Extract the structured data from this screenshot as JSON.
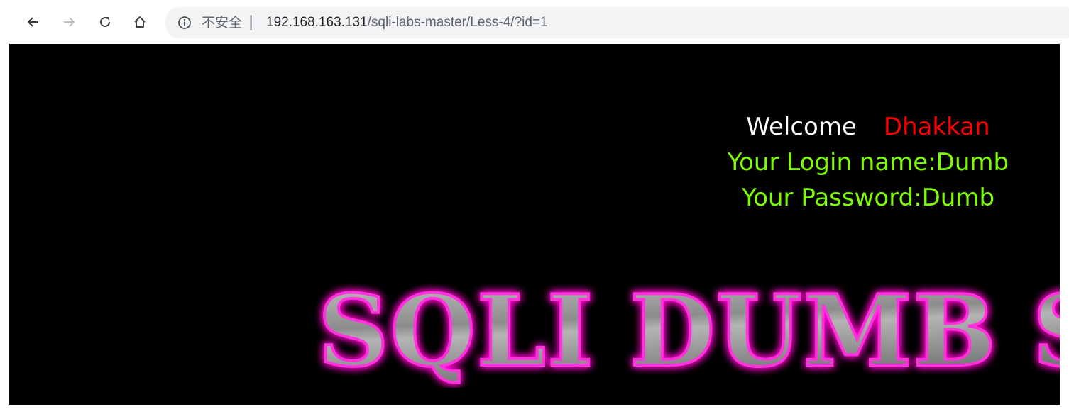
{
  "browser": {
    "security_label": "不安全",
    "separator": "|",
    "url_host": "192.168.163.131",
    "url_path": "/sqli-labs-master/Less-4/?id=1",
    "icons": {
      "back": "back-arrow-icon",
      "forward": "forward-arrow-icon",
      "reload": "reload-icon",
      "home": "home-icon",
      "info": "info-icon"
    }
  },
  "page": {
    "welcome_word": "Welcome",
    "welcome_name": "Dhakkan",
    "login_name": "Your Login name:Dumb",
    "password": "Your Password:Dumb",
    "logo_text": "SQLI DUMB SE",
    "colors": {
      "background": "#000000",
      "welcome": "#ffffff",
      "name": "#ff0000",
      "credentials": "#7cfc00",
      "logo_glow": "#ff00cc",
      "logo_fill": "#9a9a9a"
    }
  }
}
